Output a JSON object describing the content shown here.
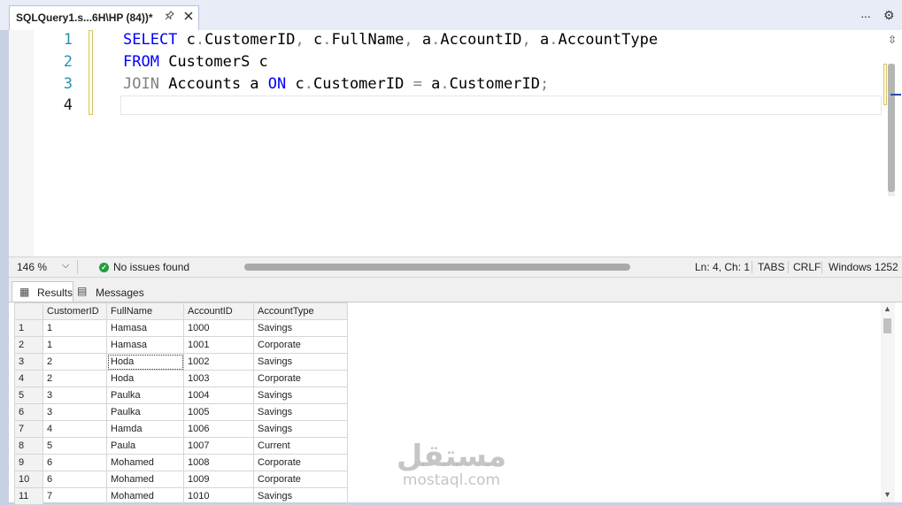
{
  "document_tab": {
    "title": "SQLQuery1.s...6H\\HP (84))*",
    "pin_icon": "pin-icon",
    "close_icon": "close-icon"
  },
  "tab_actions": {
    "overflow_icon": "ellipsis-icon",
    "overflow_glyph": "···",
    "settings_icon": "gear-icon",
    "settings_glyph": "⚙"
  },
  "editor": {
    "line_numbers": [
      "1",
      "2",
      "3",
      "4"
    ],
    "lines": [
      {
        "t1": "SELECT",
        "t2": " c",
        "t3": ".",
        "t4": "CustomerID",
        "t5": ",",
        "t6": " c",
        "t7": ".",
        "t8": "FullName",
        "t9": ",",
        "t10": " a",
        "t11": ".",
        "t12": "AccountID",
        "t13": ",",
        "t14": " a",
        "t15": ".",
        "t16": "AccountType"
      },
      {
        "t1": "FROM",
        "t2": " CustomerS c"
      },
      {
        "t1": "JOIN",
        "t2": " Accounts a ",
        "t3": "ON",
        "t4": " c",
        "t5": ".",
        "t6": "CustomerID ",
        "t7": "=",
        "t8": " a",
        "t9": ".",
        "t10": "CustomerID",
        "t11": ";"
      }
    ],
    "split_glyph": "⇳"
  },
  "statusbar": {
    "zoom": "146 %",
    "zoom_caret": "⌵",
    "issues": "No issues found",
    "issues_glyph": "✓",
    "position": "Ln: 4, Ch: 1",
    "indent": "TABS",
    "line_ending": "CRLF",
    "encoding": "Windows 1252"
  },
  "results_tabs": [
    {
      "label": "Results",
      "icon": "grid-icon",
      "glyph": "▦"
    },
    {
      "label": "Messages",
      "icon": "messages-icon",
      "glyph": "▤"
    }
  ],
  "grid": {
    "columns": [
      "CustomerID",
      "FullName",
      "AccountID",
      "AccountType"
    ],
    "rows": [
      [
        "1",
        "1",
        "Hamasa",
        "1000",
        "Savings"
      ],
      [
        "2",
        "1",
        "Hamasa",
        "1001",
        "Corporate"
      ],
      [
        "3",
        "2",
        "Hoda",
        "1002",
        "Savings"
      ],
      [
        "4",
        "2",
        "Hoda",
        "1003",
        "Corporate"
      ],
      [
        "5",
        "3",
        "Paulka",
        "1004",
        "Savings"
      ],
      [
        "6",
        "3",
        "Paulka",
        "1005",
        "Savings"
      ],
      [
        "7",
        "4",
        "Hamda",
        "1006",
        "Savings"
      ],
      [
        "8",
        "5",
        "Paula",
        "1007",
        "Current"
      ],
      [
        "9",
        "6",
        "Mohamed",
        "1008",
        "Corporate"
      ],
      [
        "10",
        "6",
        "Mohamed",
        "1009",
        "Corporate"
      ],
      [
        "11",
        "7",
        "Mohamed",
        "1010",
        "Savings"
      ]
    ],
    "scroll_up": "▲",
    "scroll_down": "▼"
  },
  "watermark": {
    "arabic": "مستقل",
    "latin": "mostaql.com"
  },
  "colors": {
    "keyword": "#0000ff",
    "line_number": "#2b91af",
    "operator": "#808080",
    "ok": "#1f9f3a"
  }
}
